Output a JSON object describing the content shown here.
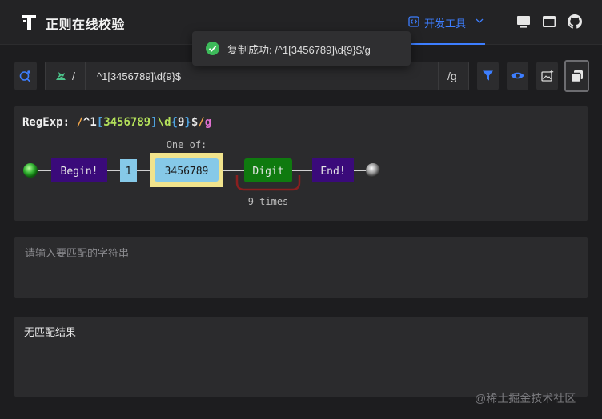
{
  "header": {
    "title": "正则在线校验",
    "tools_tab": "开发工具",
    "icons": [
      "logo-icon",
      "code-icon",
      "chevron-down-icon",
      "monitor-icon",
      "window-icon",
      "github-icon"
    ]
  },
  "toast": {
    "message": "复制成功: /^1[3456789]\\d{9}$/g",
    "status_color": "#3dba5a"
  },
  "regex": {
    "prefix": "/",
    "value": "^1[3456789]\\d{9}$",
    "suffix": "/g"
  },
  "diagram": {
    "label": "RegExp: ",
    "slash_open": "/",
    "caret": "^",
    "one": "1",
    "bracket_open": "[",
    "class_content": "3456789",
    "bracket_close": "]",
    "escape": "\\d",
    "brace_open": "{",
    "quant_num": "9",
    "brace_close": "}",
    "dollar": "$",
    "slash_close": "/",
    "flag": "g",
    "nodes": {
      "begin": "Begin!",
      "literal": "1",
      "one_of": "One of:",
      "charset": "3456789",
      "digit": "Digit",
      "times": "9 times",
      "end": "End!"
    }
  },
  "test_input": {
    "placeholder": "请输入要匹配的字符串",
    "value": ""
  },
  "result": {
    "text": "无匹配结果"
  },
  "watermark": "@稀土掘金技术社区",
  "colors": {
    "accent": "#3d7eff",
    "begin_end": "#3a0a7a",
    "literal": "#86c9e8",
    "charset_border": "#f1e38c",
    "digit": "#0f7a0f",
    "repeat_loop": "#8a1f1f"
  }
}
